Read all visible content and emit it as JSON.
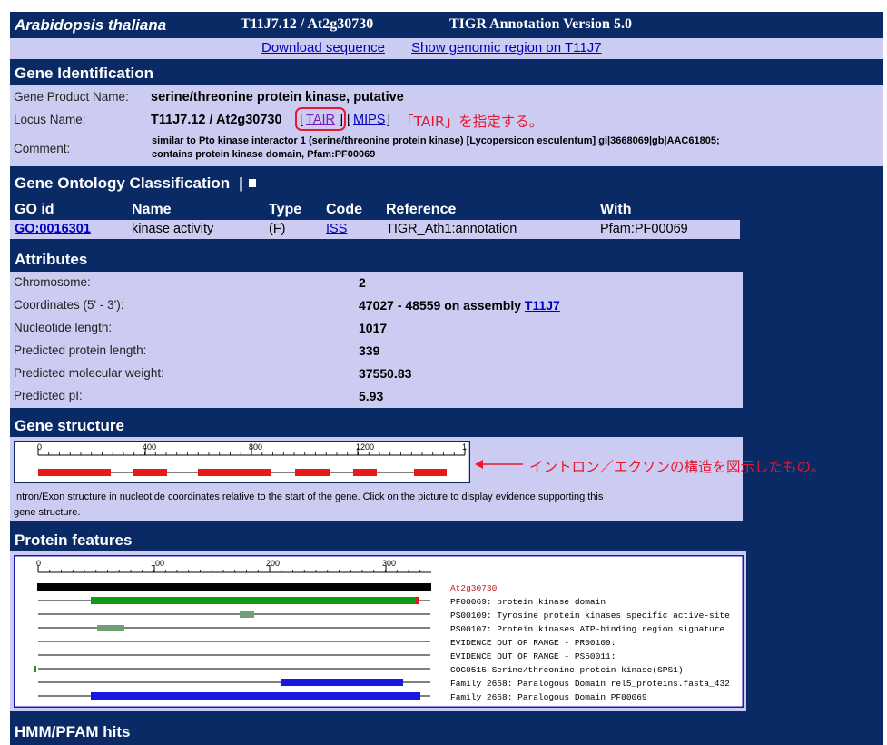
{
  "header": {
    "species": "Arabidopsis thaliana",
    "locus_title": "T11J7.12 / At2g30730",
    "version": "TIGR Annotation Version 5.0"
  },
  "links": {
    "download": "Download sequence",
    "genomic_region": "Show genomic region on T11J7"
  },
  "gene_identification": {
    "title": "Gene Identification",
    "product_label": "Gene Product Name:",
    "product_value": "serine/threonine protein kinase, putative",
    "locus_label": "Locus Name:",
    "locus_value": "T11J7.12 / At2g30730",
    "tair_link": "TAIR",
    "mips_link": "MIPS",
    "bracket_open": "[",
    "bracket_mid": "] [",
    "bracket_close": "]",
    "annotation": "「TAIR」を指定する。",
    "comment_label": "Comment:",
    "comment_line1": "similar to Pto kinase interactor 1 (serine/threonine protein kinase) [Lycopersicon esculentum] gi|3668069|gb|AAC61805;",
    "comment_line2": "contains protein kinase domain, Pfam:PF00069"
  },
  "go": {
    "title": "Gene Ontology Classification",
    "headers": [
      "GO id",
      "Name",
      "Type",
      "Code",
      "Reference",
      "With"
    ],
    "row": {
      "go_id": "GO:0016301",
      "name": "kinase activity",
      "type": "(F)",
      "code": "ISS",
      "reference": "TIGR_Ath1:annotation",
      "with": "Pfam:PF00069"
    }
  },
  "attributes": {
    "title": "Attributes",
    "rows": [
      {
        "label": "Chromosome:",
        "value": "2"
      },
      {
        "label": "Coordinates (5' - 3'):",
        "value": "47027 - 48559 on assembly",
        "link": "T11J7"
      },
      {
        "label": "Nucleotide length:",
        "value": "1017"
      },
      {
        "label": "Predicted protein length:",
        "value": "339"
      },
      {
        "label": "Predicted molecular weight:",
        "value": "37550.83"
      },
      {
        "label": "Predicted pI:",
        "value": "5.93"
      }
    ]
  },
  "gene_structure": {
    "title": "Gene structure",
    "ticks": [
      "0",
      "400",
      "800",
      "1200",
      "1"
    ],
    "annotation": "イントロン／エクソンの構造を図示したもの。",
    "caption_line1": "Intron/Exon structure in nucleotide coordinates relative to the start of the gene. Click on the picture to display evidence supporting this",
    "caption_line2": "gene structure."
  },
  "protein_features": {
    "title": "Protein features",
    "ticks": [
      "0",
      "100",
      "200",
      "300"
    ],
    "tracks": [
      "At2g30730",
      "PF00069: protein kinase domain",
      "PS00109: Tyrosine protein kinases specific active-site",
      "PS00107: Protein kinases ATP-binding region signature",
      "EVIDENCE OUT OF RANGE - PR00109:",
      "EVIDENCE OUT OF RANGE - PS50011:",
      "COG0515 Serine/threonine protein kinase(SPS1)",
      "Family 2668: Paralogous Domain rel5_proteins.fasta_432",
      "Family 2668: Paralogous Domain PF00069"
    ]
  },
  "hmm": {
    "title": "HMM/PFAM hits"
  },
  "colors": {
    "navy": "#0a2a66",
    "panel": "#ccccf2",
    "exon": "#e81818",
    "pfam": "#139a13",
    "prosite": "#6f9f74",
    "family": "#1818e0",
    "annotation": "#e8162e"
  }
}
